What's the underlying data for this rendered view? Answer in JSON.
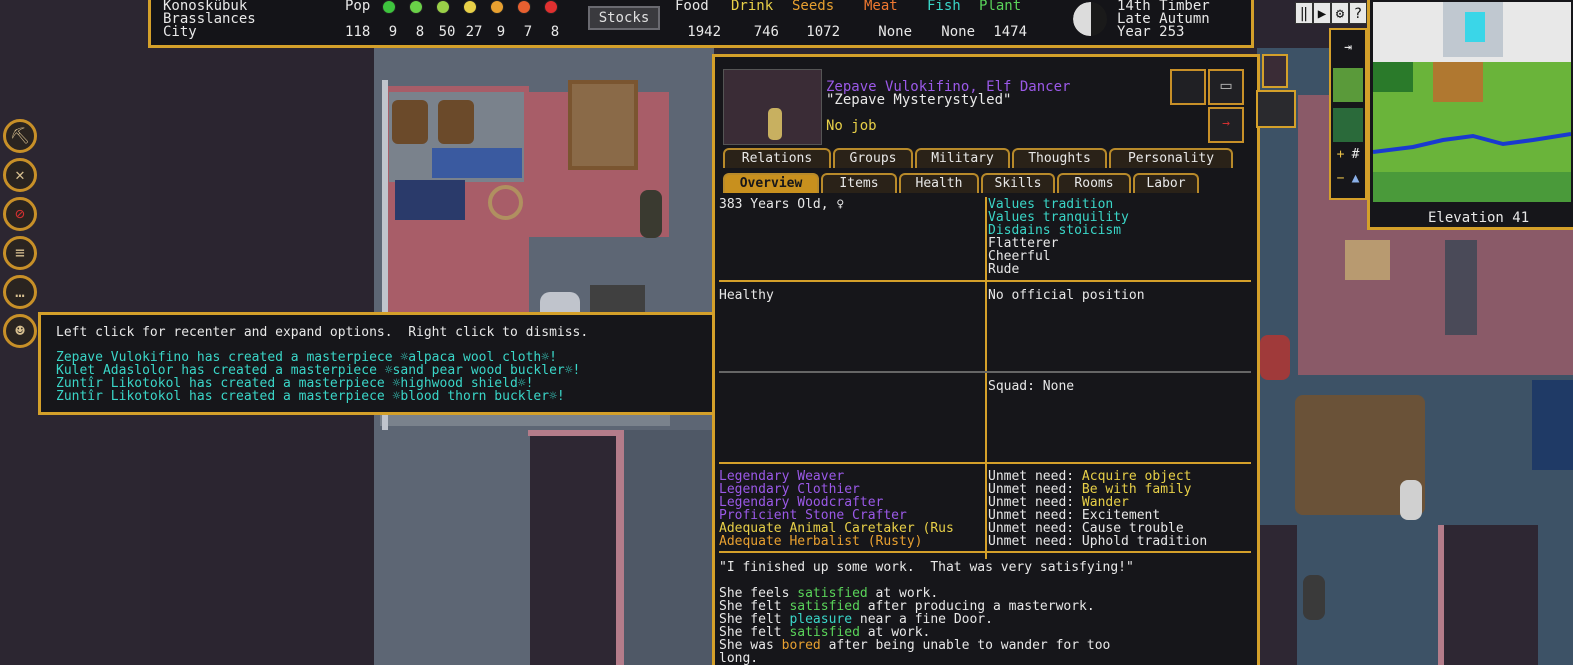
{
  "fortress": {
    "name": "Konoskûbuk",
    "civ": "Brasslances",
    "rank": "City"
  },
  "population": {
    "label": "Pop",
    "total": "118",
    "moods": [
      "9",
      "8",
      "50",
      "27",
      "9",
      "7",
      "8"
    ],
    "mood_colors": [
      "#3ec43e",
      "#6ad048",
      "#9ad048",
      "#e8d048",
      "#e8a030",
      "#e86030",
      "#e03030"
    ]
  },
  "stocks_button": "Stocks",
  "resources": [
    {
      "label": "Food",
      "value": "1942",
      "color": "#e8e8e8"
    },
    {
      "label": "Drink",
      "value": "746",
      "color": "#e8d048"
    },
    {
      "label": "Seeds",
      "value": "1072",
      "color": "#e8a030"
    },
    {
      "label": "Meat",
      "value": "None",
      "color": "#f07830"
    },
    {
      "label": "Fish",
      "value": "None",
      "color": "#3ad6c8"
    },
    {
      "label": "Plant",
      "value": "1474",
      "color": "#5ad45a"
    }
  ],
  "date": {
    "day": "14th Timber",
    "season": "Late Autumn",
    "year": "Year 253"
  },
  "notification": {
    "hint": "Left click for recenter and expand options.  Right click to dismiss.",
    "messages": [
      "Zepave Vulokifino has created a masterpiece ☼alpaca wool cloth☼!",
      "Kulet Adaslolor has created a masterpiece ☼sand pear wood buckler☼!",
      "Zuntîr Likotokol has created a masterpiece ☼highwood shield☼!",
      "Zuntîr Likotokol has created a masterpiece ☼blood thorn buckler☼!"
    ]
  },
  "unit": {
    "name_line": "Zepave Vulokifino, Elf Dancer",
    "nickname": "\"Zepave Mysterystyled\"",
    "job": "No job",
    "tabs_row1": [
      "Relations",
      "Groups",
      "Military",
      "Thoughts",
      "Personality"
    ],
    "tabs_row2": [
      "Overview",
      "Items",
      "Health",
      "Skills",
      "Rooms",
      "Labor"
    ],
    "active_tab": "Overview",
    "age": "383 Years Old, ♀",
    "values": [
      {
        "text": "Values tradition",
        "color": "#3ad6c8"
      },
      {
        "text": "Values tranquility",
        "color": "#3ad6c8"
      },
      {
        "text": "Disdains stoicism",
        "color": "#3ad6c8"
      },
      {
        "text": "Flatterer",
        "color": "#e8e8e8"
      },
      {
        "text": "Cheerful",
        "color": "#e8e8e8"
      },
      {
        "text": "Rude",
        "color": "#e8e8e8"
      }
    ],
    "health": "Healthy",
    "position": "No official position",
    "squad": "Squad: None",
    "skills": [
      {
        "text": "Legendary Weaver",
        "color": "#9b59e8"
      },
      {
        "text": "Legendary Clothier",
        "color": "#9b59e8"
      },
      {
        "text": "Legendary Woodcrafter",
        "color": "#9b59e8"
      },
      {
        "text": "Proficient Stone Crafter",
        "color": "#9b59e8"
      },
      {
        "text": "Adequate Animal Caretaker (Rus",
        "color": "#e8d048"
      },
      {
        "text": "Adequate Herbalist (Rusty)",
        "color": "#e8a030"
      }
    ],
    "needs_label": "Unmet need:",
    "needs": [
      {
        "text": "Acquire object",
        "color": "#e8d048"
      },
      {
        "text": "Be with family",
        "color": "#e8d048"
      },
      {
        "text": "Wander",
        "color": "#e8d048"
      },
      {
        "text": "Excitement",
        "color": "#e8e8e8"
      },
      {
        "text": "Cause trouble",
        "color": "#e8e8e8"
      },
      {
        "text": "Uphold tradition",
        "color": "#e8e8e8"
      }
    ],
    "quote": "\"I finished up some work.  That was very satisfying!\"",
    "thoughts": [
      {
        "pre": "She feels ",
        "em": "satisfied",
        "post": " at work.",
        "color": "#5ad45a"
      },
      {
        "pre": "She felt ",
        "em": "satisfied",
        "post": " after producing a masterwork.",
        "color": "#5ad45a"
      },
      {
        "pre": "She felt ",
        "em": "pleasure",
        "post": " near a fine Door.",
        "color": "#3ad6c8"
      },
      {
        "pre": "She felt ",
        "em": "satisfied",
        "post": " at work.",
        "color": "#5ad45a"
      },
      {
        "pre": "She was ",
        "em": "bored",
        "post": " after being unable to wander for too",
        "color": "#e8a030"
      },
      {
        "pre": "long.",
        "em": "",
        "post": "",
        "color": "#e8e8e8"
      }
    ]
  },
  "minimap": {
    "elevation": "Elevation 41"
  },
  "controls": {
    "pause": "‖",
    "play": "▶",
    "settings": "⚙",
    "help": "?"
  }
}
